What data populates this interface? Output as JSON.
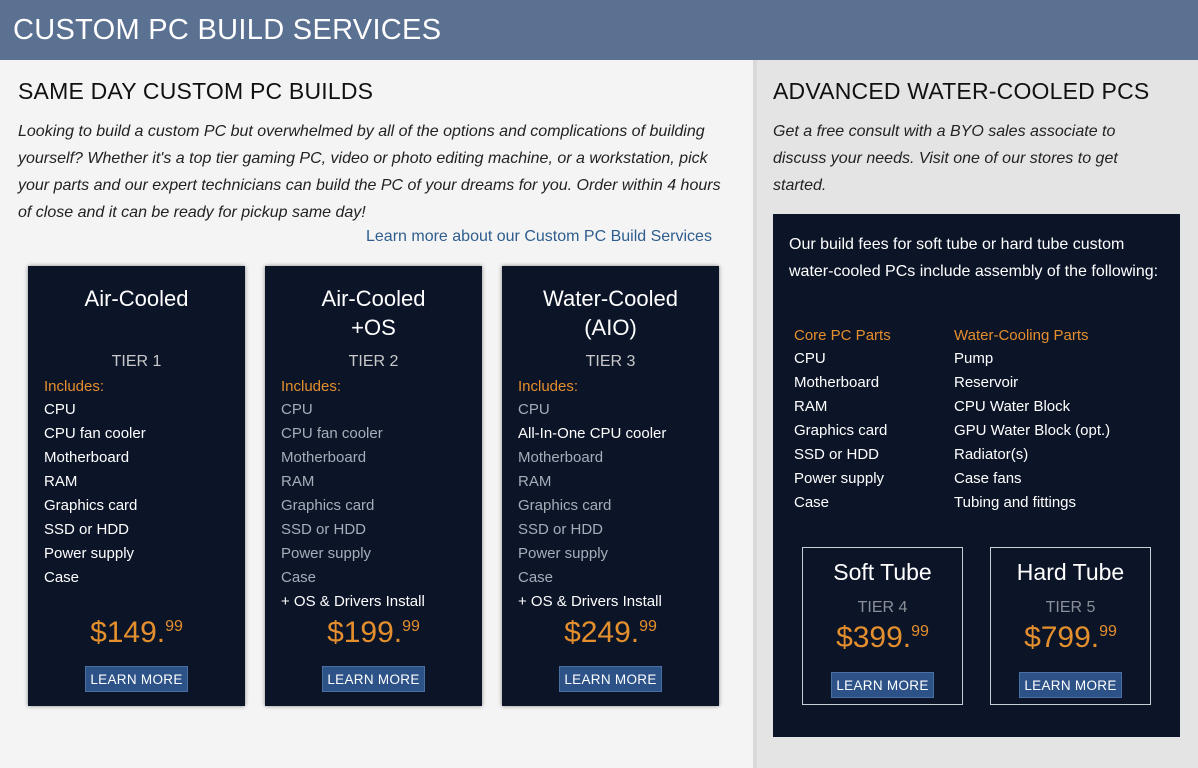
{
  "header": {
    "title": "CUSTOM PC BUILD SERVICES"
  },
  "same_day": {
    "title": "SAME DAY CUSTOM PC BUILDS",
    "intro": "Looking to build a custom PC but overwhelmed by all of the options and complications of building yourself? Whether it's a top tier gaming PC, video or photo editing machine, or a workstation, pick your parts and our expert technicians can build the PC of your dreams for you. Order within 4 hours of close and it can be ready for pickup same day!",
    "link": "Learn more about our Custom PC Build Services"
  },
  "cards": [
    {
      "title_line1": "Air-Cooled",
      "title_line2": "",
      "tier": "TIER 1",
      "includes_label": "Includes:",
      "items": [
        "CPU",
        "CPU fan cooler",
        "Motherboard",
        "RAM",
        "Graphics card",
        "SSD or HDD",
        "Power supply",
        "Case"
      ],
      "price_main": "$149.",
      "price_cents": "99",
      "button": "LEARN MORE"
    },
    {
      "title_line1": "Air-Cooled",
      "title_line2": "+OS",
      "tier": "TIER 2",
      "includes_label": "Includes:",
      "items": [
        "CPU",
        "CPU fan cooler",
        "Motherboard",
        "RAM",
        "Graphics card",
        "SSD or HDD",
        "Power supply",
        "Case",
        "+ OS & Drivers Install"
      ],
      "price_main": "$199.",
      "price_cents": "99",
      "button": "LEARN MORE"
    },
    {
      "title_line1": "Water-Cooled",
      "title_line2": "(AIO)",
      "tier": "TIER 3",
      "includes_label": "Includes:",
      "items": [
        "CPU",
        "All-In-One CPU cooler",
        "Motherboard",
        "RAM",
        "Graphics card",
        "SSD or HDD",
        "Power supply",
        "Case",
        "+ OS & Drivers Install"
      ],
      "price_main": "$249.",
      "price_cents": "99",
      "button": "LEARN MORE"
    }
  ],
  "water_cooled": {
    "title": "ADVANCED WATER-COOLED PCS",
    "intro": "Get a free consult with a BYO sales associate to discuss your needs. Visit one of our stores to get started.",
    "box_intro": "Our build fees for soft tube or hard tube custom water-cooled PCs include assembly of the following:",
    "core_head": "Core PC Parts",
    "core_items": [
      "CPU",
      "Motherboard",
      "RAM",
      "Graphics card",
      "SSD or HDD",
      "Power supply",
      "Case"
    ],
    "water_head": "Water-Cooling Parts",
    "water_items": [
      "Pump",
      "Reservoir",
      "CPU Water Block",
      "GPU Water Block (opt.)",
      "Radiator(s)",
      "Case fans",
      "Tubing and fittings"
    ],
    "options": [
      {
        "title": "Soft Tube",
        "tier": "TIER 4",
        "price_main": "$399.",
        "price_cents": "99",
        "button": "LEARN MORE"
      },
      {
        "title": "Hard Tube",
        "tier": "TIER 5",
        "price_main": "$799.",
        "price_cents": "99",
        "button": "LEARN MORE"
      }
    ]
  },
  "colors": {
    "header_bg": "#5b7191",
    "card_bg": "#0c1428",
    "accent_orange": "#e48f2d",
    "button_bg": "#2c5288",
    "link": "#2e5d8e"
  }
}
